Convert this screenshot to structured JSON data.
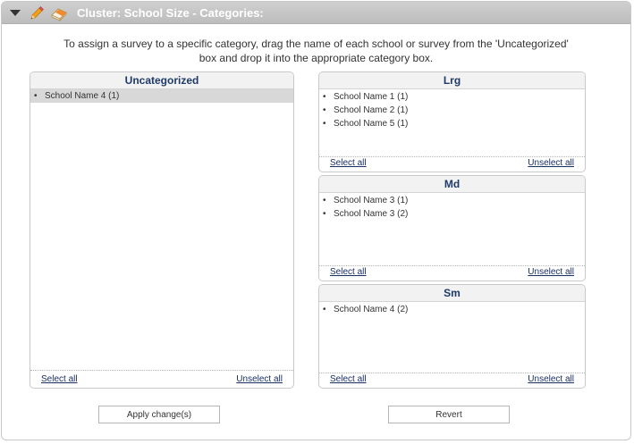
{
  "header": {
    "title": "Cluster: School Size - Categories:"
  },
  "instructions": {
    "line1": "To assign a survey to a specific category, drag the name of each school or survey from the 'Uncategorized'",
    "line2": "box and drop it into the appropriate category box."
  },
  "uncategorized": {
    "title": "Uncategorized",
    "items": [
      "School Name 4 (1)"
    ],
    "select_all": "Select all",
    "unselect_all": "Unselect all"
  },
  "categories": [
    {
      "title": "Lrg",
      "items": [
        "School Name 1 (1)",
        "School Name 2 (1)",
        "School Name 5 (1)"
      ],
      "select_all": "Select all",
      "unselect_all": "Unselect all"
    },
    {
      "title": "Md",
      "items": [
        "School Name 3 (1)",
        "School Name 3 (2)"
      ],
      "select_all": "Select all",
      "unselect_all": "Unselect all"
    },
    {
      "title": "Sm",
      "items": [
        "School Name 4 (2)"
      ],
      "select_all": "Select all",
      "unselect_all": "Unselect all"
    }
  ],
  "buttons": {
    "apply": "Apply change(s)",
    "revert": "Revert"
  },
  "icons": [
    "chevron-down-icon",
    "pencil-icon",
    "eraser-icon"
  ]
}
